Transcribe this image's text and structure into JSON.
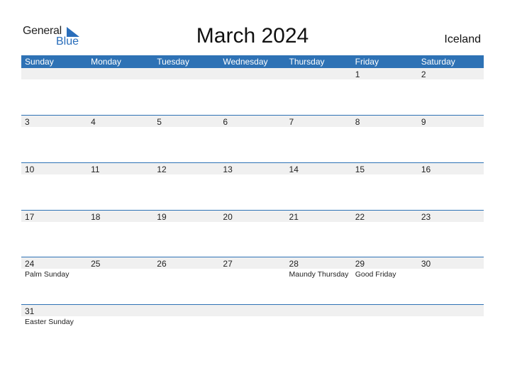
{
  "logo": {
    "general": "General",
    "blue": "Blue"
  },
  "title": "March 2024",
  "country": "Iceland",
  "colors": {
    "header": "#2e72b5",
    "strip": "#f0f0f0"
  },
  "weekdays": [
    "Sunday",
    "Monday",
    "Tuesday",
    "Wednesday",
    "Thursday",
    "Friday",
    "Saturday"
  ],
  "weeks": [
    [
      {
        "d": ""
      },
      {
        "d": ""
      },
      {
        "d": ""
      },
      {
        "d": ""
      },
      {
        "d": ""
      },
      {
        "d": "1"
      },
      {
        "d": "2"
      }
    ],
    [
      {
        "d": "3"
      },
      {
        "d": "4"
      },
      {
        "d": "5"
      },
      {
        "d": "6"
      },
      {
        "d": "7"
      },
      {
        "d": "8"
      },
      {
        "d": "9"
      }
    ],
    [
      {
        "d": "10"
      },
      {
        "d": "11"
      },
      {
        "d": "12"
      },
      {
        "d": "13"
      },
      {
        "d": "14"
      },
      {
        "d": "15"
      },
      {
        "d": "16"
      }
    ],
    [
      {
        "d": "17"
      },
      {
        "d": "18"
      },
      {
        "d": "19"
      },
      {
        "d": "20"
      },
      {
        "d": "21"
      },
      {
        "d": "22"
      },
      {
        "d": "23"
      }
    ],
    [
      {
        "d": "24",
        "h": "Palm Sunday"
      },
      {
        "d": "25"
      },
      {
        "d": "26"
      },
      {
        "d": "27"
      },
      {
        "d": "28",
        "h": "Maundy Thursday"
      },
      {
        "d": "29",
        "h": "Good Friday"
      },
      {
        "d": "30"
      }
    ],
    [
      {
        "d": "31",
        "h": "Easter Sunday"
      },
      {
        "d": ""
      },
      {
        "d": ""
      },
      {
        "d": ""
      },
      {
        "d": ""
      },
      {
        "d": ""
      },
      {
        "d": ""
      }
    ]
  ]
}
